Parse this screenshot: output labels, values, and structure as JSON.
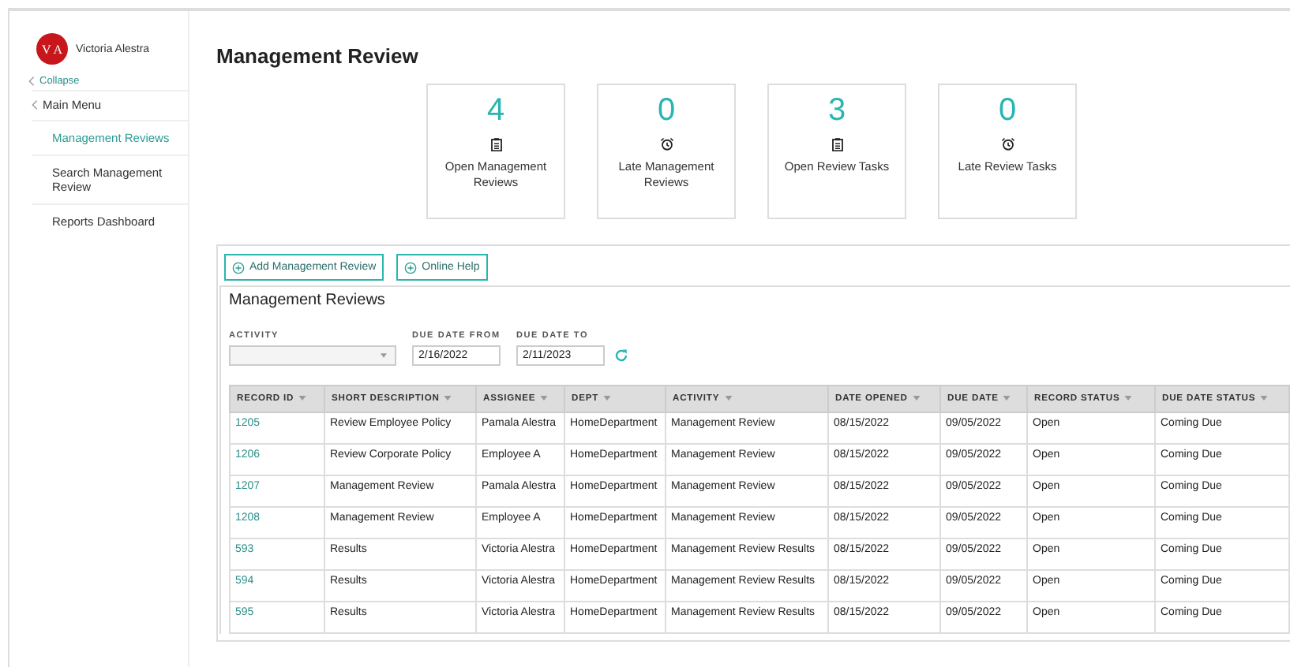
{
  "user": {
    "initials": "V A",
    "name": "Victoria Alestra"
  },
  "sidebar": {
    "collapse": "Collapse",
    "back": "Main Menu",
    "items": [
      {
        "label": "Management Reviews",
        "selected": true
      },
      {
        "label": "Search Management Review",
        "selected": false
      },
      {
        "label": "Reports Dashboard",
        "selected": false
      }
    ]
  },
  "page_title": "Management Review",
  "cards": [
    {
      "count": "4",
      "kind": "open",
      "label": "Open Management Reviews"
    },
    {
      "count": "0",
      "kind": "late",
      "label": "Late Management Reviews"
    },
    {
      "count": "3",
      "kind": "open",
      "label": "Open Review Tasks"
    },
    {
      "count": "0",
      "kind": "late",
      "label": "Late Review Tasks"
    }
  ],
  "actions": [
    "Add Management Review",
    "Online Help"
  ],
  "section_title": "Management Reviews",
  "filters": {
    "activity": {
      "label": "ACTIVITY"
    },
    "from": {
      "label": "DUE DATE FROM",
      "value": "2/16/2022"
    },
    "to": {
      "label": "DUE DATE TO",
      "value": "2/11/2023"
    }
  },
  "table": {
    "columns": [
      "RECORD ID",
      "SHORT DESCRIPTION",
      "ASSIGNEE",
      "DEPT",
      "ACTIVITY",
      "DATE OPENED",
      "DUE DATE",
      "RECORD STATUS",
      "DUE DATE STATUS"
    ],
    "rows": [
      [
        "1205",
        "Review Employee Policy",
        "Pamala Alestra",
        "HomeDepartment",
        "Management Review",
        "08/15/2022",
        "09/05/2022",
        "Open",
        "Coming Due"
      ],
      [
        "1206",
        "Review Corporate Policy",
        "Employee A",
        "HomeDepartment",
        "Management Review",
        "08/15/2022",
        "09/05/2022",
        "Open",
        "Coming Due"
      ],
      [
        "1207",
        "Management Review",
        "Pamala Alestra",
        "HomeDepartment",
        "Management Review",
        "08/15/2022",
        "09/05/2022",
        "Open",
        "Coming Due"
      ],
      [
        "1208",
        "Management Review",
        "Employee A",
        "HomeDepartment",
        "Management Review",
        "08/15/2022",
        "09/05/2022",
        "Open",
        "Coming Due"
      ],
      [
        "593",
        "Results",
        "Victoria Alestra",
        "HomeDepartment",
        "Management Review Results",
        "08/15/2022",
        "09/05/2022",
        "Open",
        "Coming Due"
      ],
      [
        "594",
        "Results",
        "Victoria Alestra",
        "HomeDepartment",
        "Management Review Results",
        "08/15/2022",
        "09/05/2022",
        "Open",
        "Coming Due"
      ],
      [
        "595",
        "Results",
        "Victoria Alestra",
        "HomeDepartment",
        "Management Review Results",
        "08/15/2022",
        "09/05/2022",
        "Open",
        "Coming Due"
      ]
    ]
  }
}
